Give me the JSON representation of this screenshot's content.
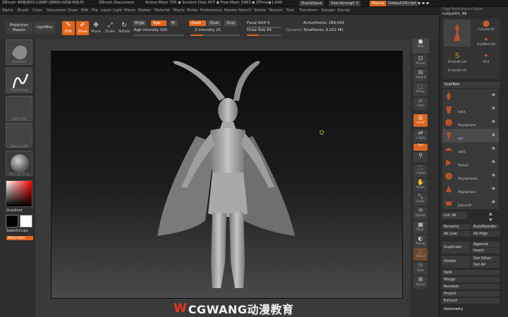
{
  "titlebar": {
    "app": "ZBrush 4R6",
    "license": "[9JD3-LQWP-Q8RN-DZNI-N9LP]",
    "doc": "ZBrush Document",
    "stats": "Active Mem 705 ◆ Scratch Disk 457 ◆ Free Mem 1983 ◆ ZTime◆1.640",
    "quicksave": "QuickSave",
    "seethrough": "See-through   0",
    "menus_btn": "Menus",
    "script": "DefaultZScript"
  },
  "menubar": [
    "Alpha",
    "Brush",
    "Color",
    "Document",
    "Draw",
    "Edit",
    "File",
    "Layer",
    "Light",
    "Macro",
    "Marker",
    "Material",
    "Movie",
    "Picker",
    "Preferences",
    "Render",
    "Stencil",
    "Stroke",
    "Texture",
    "Tool",
    "Transform",
    "Zplugin",
    "Zscript"
  ],
  "shelf": {
    "projection_master": "Projection Master",
    "lightbox": "LightBox",
    "edit": "Edit",
    "draw": "Draw",
    "move": "Move",
    "scale": "Scale",
    "rotate": "Rotate",
    "mrgb": "Mrgb",
    "rgb": "Rgb",
    "m": "M",
    "zadd": "Zadd",
    "zsub": "Zsub",
    "zcut": "Zcut",
    "rgb_intensity": "Rgb  Intensity 100",
    "z_intensity": "Z  Intensity 25",
    "focal_shift": "Focal Shift 0",
    "draw_size": "Draw Size 64",
    "dynamic": "Dynamic",
    "active_points": "ActivePoints: 269,043",
    "total_points": "TotalPoints: 6.022 Mil"
  },
  "lefttray": {
    "tools": [
      "Standard",
      "ClayBuildup",
      "Alpha Off",
      "Texture Off",
      "MatCap Gray"
    ],
    "gradient": "Gradient",
    "switchcolor": "SwitchColor",
    "alternate": "Alternate"
  },
  "dock": [
    "SPix",
    "Actual",
    "AAHalf",
    "Persp",
    "Floor",
    "Local",
    "L.Sym",
    "Xyz",
    "Frame",
    "Move",
    "Scale",
    "Rotate",
    "PolyF",
    "Transp",
    "Ghost",
    "Solo",
    "Xpose"
  ],
  "rightpanel": {
    "header": "Copy  Paste  Import  Export",
    "tool_name": "nvlijuli01_48",
    "tool_thumbs": [
      "SimpleBrush",
      "Cylinder3D",
      "PolyMesh3D",
      "IMM",
      "NCS",
      "SimpleBrush"
    ],
    "subtool_title": "SubTool",
    "subtools": [
      "",
      "lvzia",
      "PolySphere",
      "ear",
      "vz03",
      "Plane3",
      "PolySphere1",
      "PolySphere",
      "Extract9"
    ],
    "list_all": "List All",
    "rename": "Rename",
    "autoreorder": "AutoReorder",
    "all_low": "All Low",
    "all_high": "All High",
    "duplicate": "Duplicate",
    "append": "Append",
    "insert": "Insert",
    "delete": "Delete",
    "del_other": "Del Other",
    "del_all": "Del All",
    "split": "Split",
    "merge": "Merge",
    "remesh": "Remesh",
    "project": "Project",
    "extract": "Extract",
    "geometry": "Geometry"
  },
  "watermark": {
    "logo": "W",
    "text": "CGWANG动漫教育"
  },
  "colors": {
    "accent": "#e2661a",
    "panel": "#2a2a2a",
    "canvas_top": "#0c0c0c",
    "canvas_bottom": "#4a4a4a"
  }
}
